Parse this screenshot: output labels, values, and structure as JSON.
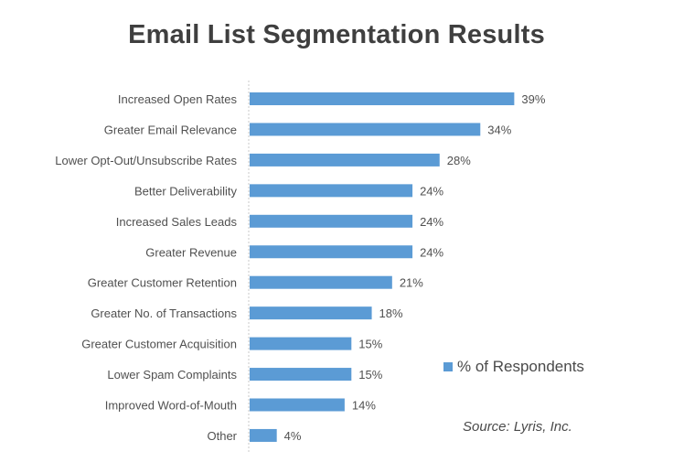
{
  "chart_data": {
    "type": "bar",
    "orientation": "horizontal",
    "title": "Email List Segmentation Results",
    "xlabel": "",
    "ylabel": "",
    "categories": [
      "Increased Open Rates",
      "Greater Email Relevance",
      "Lower Opt-Out/Unsubscribe Rates",
      "Better Deliverability",
      "Increased Sales Leads",
      "Greater Revenue",
      "Greater Customer Retention",
      "Greater No. of Transactions",
      "Greater Customer Acquisition",
      "Lower Spam Complaints",
      "Improved Word-of-Mouth",
      "Other"
    ],
    "series": [
      {
        "name": "% of Respondents",
        "values": [
          39,
          34,
          28,
          24,
          24,
          24,
          21,
          18,
          15,
          15,
          14,
          4
        ],
        "color": "#5b9bd5"
      }
    ],
    "value_labels": [
      "39%",
      "34%",
      "28%",
      "24%",
      "24%",
      "24%",
      "21%",
      "18%",
      "15%",
      "15%",
      "14%",
      "4%"
    ],
    "xlim": [
      0,
      45
    ],
    "grid": false,
    "legend": {
      "entries": [
        "% of Respondents"
      ],
      "placement": "right"
    },
    "annotations": [
      "Source: Lyris, Inc."
    ]
  },
  "legend_label": "% of Respondents",
  "source_text": "Source: Lyris, Inc."
}
